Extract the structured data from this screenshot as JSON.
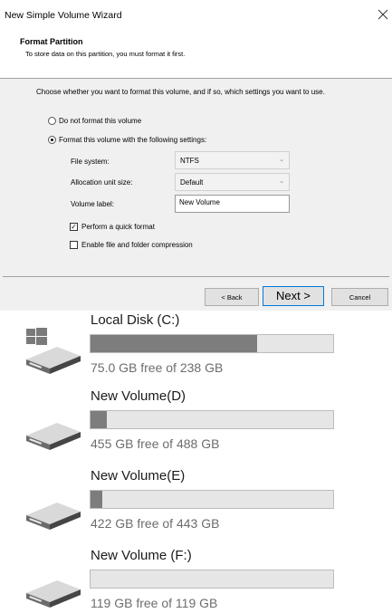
{
  "wizard": {
    "title": "New Simple Volume Wizard",
    "header_title": "Format Partition",
    "header_subtitle": "To store data on this partition, you must format it first.",
    "description": "Choose whether you want to format this volume, and if so, which settings you want to use.",
    "radio_no_format": "Do not format this volume",
    "radio_format": "Format this volume with the following settings:",
    "selected_option": "format",
    "file_system_label": "File system:",
    "file_system_value": "NTFS",
    "allocation_label": "Allocation unit size:",
    "allocation_value": "Default",
    "volume_label_label": "Volume label:",
    "volume_label_value": "New Volume",
    "quick_format_label": "Perform a quick format",
    "quick_format_checked": true,
    "compression_label": "Enable file and folder compression",
    "compression_checked": false,
    "back_label": "< Back",
    "next_label": "Next >",
    "cancel_label": "Cancel"
  },
  "drives": [
    {
      "name": "Local Disk (C:)",
      "free_text": "75.0 GB free of 238 GB",
      "used_fraction": 0.685,
      "icon": "system-drive-icon"
    },
    {
      "name": "New Volume(D)",
      "free_text": "455 GB free of 488 GB",
      "used_fraction": 0.068,
      "icon": "drive-icon"
    },
    {
      "name": "New Volume(E)",
      "free_text": "422 GB free of 443 GB",
      "used_fraction": 0.047,
      "icon": "drive-icon"
    },
    {
      "name": "New Volume (F:)",
      "free_text": "119 GB free of 119 GB",
      "used_fraction": 0.0,
      "icon": "drive-icon"
    }
  ],
  "colors": {
    "accent": "#0078d7",
    "bar_fill": "#7d7d7d",
    "bar_track": "#e6e6e6",
    "dialog_body": "#f0f0f0"
  }
}
